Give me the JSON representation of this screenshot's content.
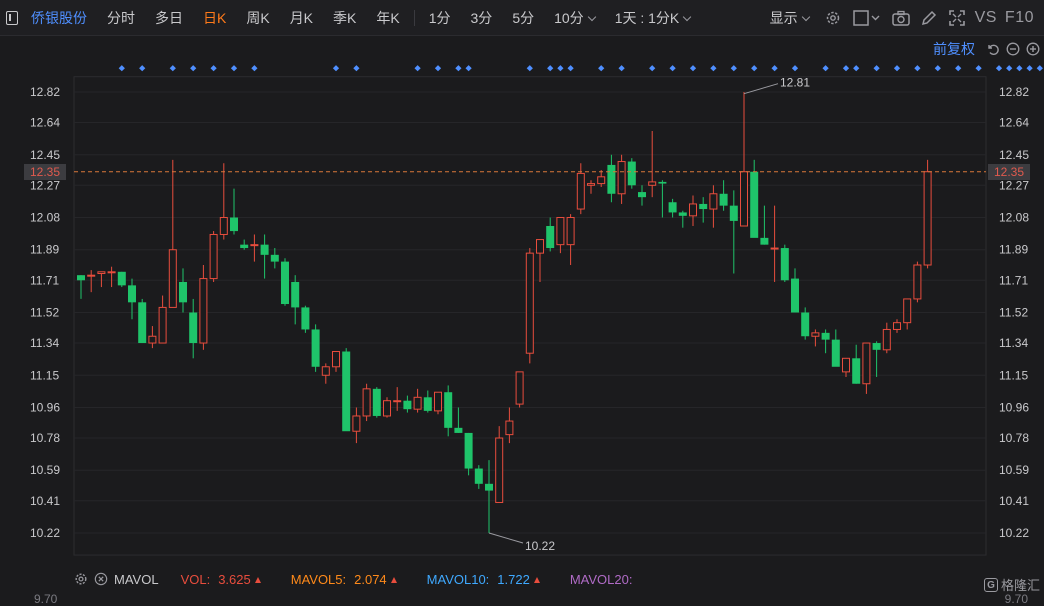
{
  "stock": {
    "name": "侨银股份"
  },
  "tabs": [
    {
      "label": "分时",
      "active": false
    },
    {
      "label": "多日",
      "active": false
    },
    {
      "label": "日K",
      "active": true
    },
    {
      "label": "周K",
      "active": false
    },
    {
      "label": "月K",
      "active": false
    },
    {
      "label": "季K",
      "active": false
    },
    {
      "label": "年K",
      "active": false
    },
    {
      "label": "1分",
      "active": false
    },
    {
      "label": "3分",
      "active": false
    },
    {
      "label": "5分",
      "active": false
    },
    {
      "label": "10分",
      "active": false,
      "dropdown": true
    },
    {
      "label": "1天 : 1分K",
      "active": false,
      "dropdown": true
    }
  ],
  "toolbar": {
    "display_label": "显示",
    "vs_label": "VS",
    "f10_label": "F10",
    "adjust_label": "前复权"
  },
  "colors": {
    "up": "#e84d3d",
    "down": "#1fc46a",
    "accent_blue": "#4f8fff",
    "active_tab": "#ff7a1a",
    "background": "#1b1b1d"
  },
  "chart_data": {
    "type": "candlestick",
    "y_ticks": [
      "12.82",
      "12.64",
      "12.45",
      "12.27",
      "12.08",
      "11.89",
      "11.71",
      "11.52",
      "11.34",
      "11.15",
      "10.96",
      "10.78",
      "10.59",
      "10.41",
      "10.22"
    ],
    "ylim": [
      10.09,
      12.91
    ],
    "current_price": "12.35",
    "annotations": {
      "high_label": "12.81",
      "low_label": "10.22",
      "high_index": 65,
      "low_index": 40
    },
    "marker_indices": [
      4,
      6,
      9,
      11,
      13,
      15,
      17,
      25,
      27,
      33,
      35,
      37,
      38,
      44,
      46,
      47,
      48,
      51,
      53,
      56,
      58,
      60,
      62,
      64,
      66,
      68,
      70,
      73,
      75,
      76,
      78,
      80,
      82,
      84,
      86,
      88,
      90,
      91,
      92,
      93,
      94
    ],
    "ohlc": [
      [
        11.74,
        11.74,
        11.6,
        11.71
      ],
      [
        11.74,
        11.77,
        11.64,
        11.74
      ],
      [
        11.75,
        11.76,
        11.67,
        11.76
      ],
      [
        11.76,
        11.79,
        11.67,
        11.76
      ],
      [
        11.76,
        11.76,
        11.67,
        11.68
      ],
      [
        11.68,
        11.72,
        11.48,
        11.58
      ],
      [
        11.58,
        11.6,
        11.34,
        11.34
      ],
      [
        11.34,
        11.44,
        11.31,
        11.38
      ],
      [
        11.34,
        11.62,
        11.34,
        11.55
      ],
      [
        11.55,
        12.42,
        11.55,
        11.89
      ],
      [
        11.7,
        11.78,
        11.52,
        11.58
      ],
      [
        11.52,
        11.6,
        11.25,
        11.34
      ],
      [
        11.34,
        11.8,
        11.3,
        11.72
      ],
      [
        11.72,
        12.0,
        11.7,
        11.98
      ],
      [
        11.98,
        12.4,
        11.95,
        12.08
      ],
      [
        12.08,
        12.25,
        11.98,
        12.0
      ],
      [
        11.92,
        11.95,
        11.89,
        11.9
      ],
      [
        11.92,
        11.98,
        11.82,
        11.92
      ],
      [
        11.92,
        11.98,
        11.72,
        11.86
      ],
      [
        11.86,
        11.9,
        11.78,
        11.82
      ],
      [
        11.82,
        11.84,
        11.56,
        11.57
      ],
      [
        11.7,
        11.74,
        11.45,
        11.55
      ],
      [
        11.55,
        11.56,
        11.4,
        11.42
      ],
      [
        11.42,
        11.45,
        11.17,
        11.2
      ],
      [
        11.15,
        11.22,
        11.1,
        11.2
      ],
      [
        11.2,
        11.28,
        11.17,
        11.29
      ],
      [
        11.29,
        11.31,
        10.85,
        10.82
      ],
      [
        10.82,
        10.96,
        10.75,
        10.91
      ],
      [
        10.91,
        11.1,
        10.88,
        11.07
      ],
      [
        11.07,
        11.08,
        10.9,
        10.91
      ],
      [
        10.91,
        11.02,
        10.9,
        11.0
      ],
      [
        11.0,
        11.08,
        10.94,
        11.0
      ],
      [
        11.0,
        11.03,
        10.93,
        10.95
      ],
      [
        10.95,
        11.07,
        10.93,
        11.02
      ],
      [
        11.02,
        11.06,
        10.93,
        10.94
      ],
      [
        10.94,
        11.05,
        10.92,
        11.05
      ],
      [
        11.05,
        11.09,
        10.79,
        10.84
      ],
      [
        10.84,
        10.96,
        10.81,
        10.81
      ],
      [
        10.81,
        10.81,
        10.56,
        10.6
      ],
      [
        10.6,
        10.62,
        10.48,
        10.51
      ],
      [
        10.51,
        10.65,
        10.22,
        10.47
      ],
      [
        10.4,
        10.85,
        10.4,
        10.78
      ],
      [
        10.8,
        10.96,
        10.75,
        10.88
      ],
      [
        10.98,
        11.17,
        10.96,
        11.17
      ],
      [
        11.28,
        11.9,
        11.22,
        11.87
      ],
      [
        11.87,
        11.95,
        11.7,
        11.95
      ],
      [
        12.03,
        12.08,
        11.88,
        11.9
      ],
      [
        11.92,
        12.08,
        11.87,
        12.08
      ],
      [
        11.92,
        12.1,
        11.8,
        12.08
      ],
      [
        12.13,
        12.4,
        12.1,
        12.34
      ],
      [
        12.27,
        12.3,
        12.22,
        12.28
      ],
      [
        12.28,
        12.36,
        12.26,
        12.32
      ],
      [
        12.39,
        12.45,
        12.17,
        12.22
      ],
      [
        12.22,
        12.45,
        12.16,
        12.41
      ],
      [
        12.41,
        12.43,
        12.25,
        12.27
      ],
      [
        12.23,
        12.27,
        12.15,
        12.2
      ],
      [
        12.27,
        12.59,
        12.2,
        12.29
      ],
      [
        12.29,
        12.3,
        12.08,
        12.28
      ],
      [
        12.17,
        12.19,
        12.08,
        12.11
      ],
      [
        12.11,
        12.12,
        12.02,
        12.09
      ],
      [
        12.09,
        12.21,
        12.03,
        12.16
      ],
      [
        12.16,
        12.2,
        12.05,
        12.13
      ],
      [
        12.13,
        12.27,
        12.02,
        12.22
      ],
      [
        12.22,
        12.3,
        12.12,
        12.15
      ],
      [
        12.15,
        12.24,
        11.75,
        12.06
      ],
      [
        12.03,
        12.82,
        12.03,
        12.35
      ],
      [
        12.35,
        12.42,
        12.2,
        11.96
      ],
      [
        11.96,
        12.15,
        11.92,
        11.92
      ],
      [
        11.9,
        12.15,
        11.7,
        11.9
      ],
      [
        11.9,
        11.92,
        11.7,
        11.71
      ],
      [
        11.72,
        11.78,
        11.6,
        11.52
      ],
      [
        11.52,
        11.55,
        11.36,
        11.38
      ],
      [
        11.38,
        11.42,
        11.32,
        11.4
      ],
      [
        11.4,
        11.42,
        11.28,
        11.36
      ],
      [
        11.36,
        11.42,
        11.22,
        11.2
      ],
      [
        11.17,
        11.25,
        11.14,
        11.25
      ],
      [
        11.25,
        11.33,
        11.1,
        11.1
      ],
      [
        11.1,
        11.3,
        11.04,
        11.34
      ],
      [
        11.34,
        11.35,
        11.14,
        11.3
      ],
      [
        11.3,
        11.46,
        11.28,
        11.42
      ],
      [
        11.42,
        11.48,
        11.4,
        11.46
      ],
      [
        11.46,
        11.6,
        11.42,
        11.6
      ],
      [
        11.6,
        11.82,
        11.58,
        11.8
      ],
      [
        11.8,
        12.42,
        11.78,
        12.35
      ]
    ]
  },
  "indicator": {
    "name": "MAVOL",
    "vol_label": "VOL:",
    "vol_value": "3.625",
    "mavol5_label": "MAVOL5:",
    "mavol5_value": "2.074",
    "mavol10_label": "MAVOL10:",
    "mavol10_value": "1.722",
    "mavol20_label": "MAVOL20:"
  },
  "watermark": {
    "text": "格隆汇"
  },
  "axis_bottom_left": "9.70",
  "axis_bottom_right": "9.70"
}
